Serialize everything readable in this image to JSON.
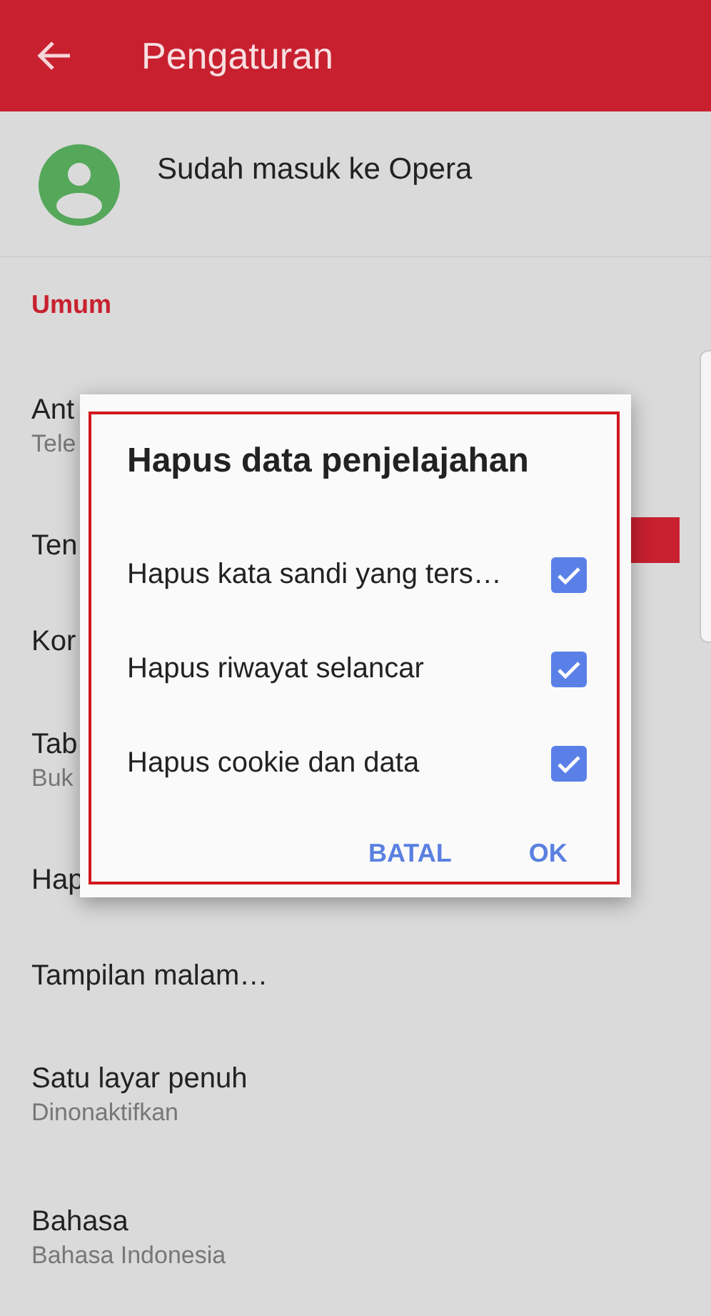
{
  "app_bar": {
    "title": "Pengaturan"
  },
  "account": {
    "label": "Sudah masuk ke Opera"
  },
  "section": {
    "title": "Umum"
  },
  "settings": [
    {
      "title": "Ant",
      "subtitle": "Tele"
    },
    {
      "title": "Ten"
    },
    {
      "title": "Kor"
    },
    {
      "title": "Tab",
      "subtitle": "Buk"
    },
    {
      "title": "Hap"
    },
    {
      "title": "Tampilan malam…"
    },
    {
      "title": "Satu layar penuh",
      "subtitle": "Dinonaktifkan"
    },
    {
      "title": "Bahasa",
      "subtitle": "Bahasa Indonesia"
    }
  ],
  "dialog": {
    "title": "Hapus data penjelajahan",
    "options": [
      {
        "label": "Hapus kata sandi yang ters…",
        "checked": true
      },
      {
        "label": "Hapus riwayat selancar",
        "checked": true
      },
      {
        "label": "Hapus cookie dan data",
        "checked": true
      }
    ],
    "buttons": [
      "BATAL",
      "OK"
    ]
  }
}
